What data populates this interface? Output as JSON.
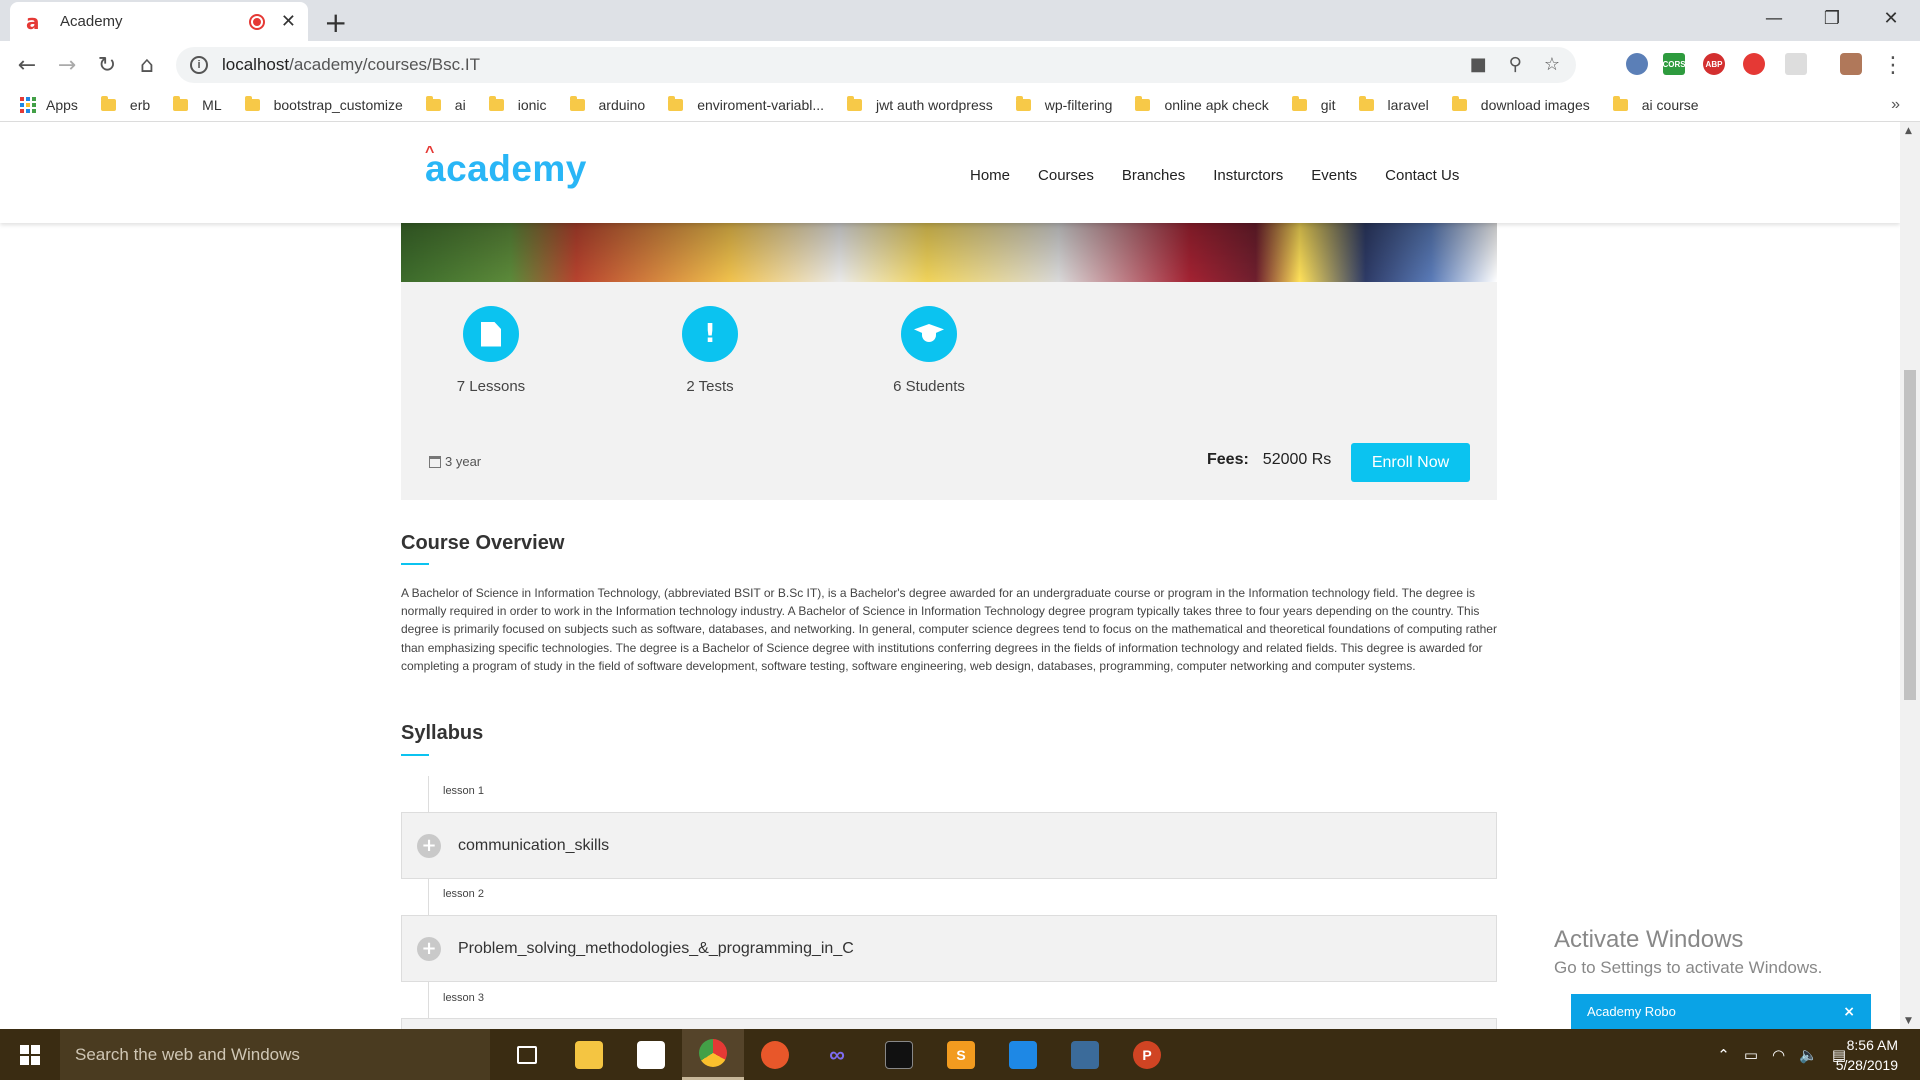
{
  "browser": {
    "tab_title": "Academy",
    "url_host": "localhost",
    "url_path": "/academy/courses/Bsc.IT",
    "bookmarks": [
      "Apps",
      "erb",
      "ML",
      "bootstrap_customize",
      "ai",
      "ionic",
      "arduino",
      "enviroment-variabl...",
      "jwt auth wordpress",
      "wp-filtering",
      "online apk check",
      "git",
      "laravel",
      "download images",
      "ai course"
    ],
    "bookmarks_more": "»",
    "extension_labels": [
      "CORS",
      "ABP"
    ]
  },
  "site": {
    "logo": "academy",
    "nav": [
      "Home",
      "Courses",
      "Branches",
      "Insturctors",
      "Events",
      "Contact Us"
    ]
  },
  "course": {
    "stats": [
      {
        "icon": "file-icon",
        "label": "7 Lessons"
      },
      {
        "icon": "exclamation-icon",
        "label": "2 Tests"
      },
      {
        "icon": "graduation-cap-icon",
        "label": "6 Students"
      }
    ],
    "duration": "3 year",
    "fees_label": "Fees:",
    "fees_value": "52000 Rs",
    "enroll_label": "Enroll Now",
    "overview_title": "Course Overview",
    "overview_text": "A Bachelor of Science in Information Technology, (abbreviated BSIT or B.Sc IT), is a Bachelor's degree awarded for an undergraduate course or program in the Information technology field. The degree is normally required in order to work in the Information technology industry. A Bachelor of Science in Information Technology degree program typically takes three to four years depending on the country. This degree is primarily focused on subjects such as software, databases, and networking. In general, computer science degrees tend to focus on the mathematical and theoretical foundations of computing rather than emphasizing specific technologies. The degree is a Bachelor of Science degree with institutions conferring degrees in the fields of information technology and related fields. This degree is awarded for completing a program of study in the field of software development, software testing, software engineering, web design, databases, programming, computer networking and computer systems.",
    "syllabus_title": "Syllabus",
    "lessons": [
      {
        "tag": "lesson 1",
        "title": "communication_skills"
      },
      {
        "tag": "lesson 2",
        "title": "Problem_solving_methodologies_&_programming_in_C"
      },
      {
        "tag": "lesson 3",
        "title": ""
      }
    ]
  },
  "watermark": {
    "title": "Activate Windows",
    "subtitle": "Go to Settings to activate Windows."
  },
  "chat": {
    "title": "Academy Robo",
    "close": "×"
  },
  "taskbar": {
    "search_placeholder": "Search the web and Windows",
    "time": "8:56 AM",
    "date": "5/28/2019"
  },
  "colors": {
    "accent": "#0bc3f0",
    "logo": "#29b6f6",
    "logo_accent": "#e53935",
    "panel_bg": "#f2f2f2",
    "taskbar": "#3a2c12"
  }
}
